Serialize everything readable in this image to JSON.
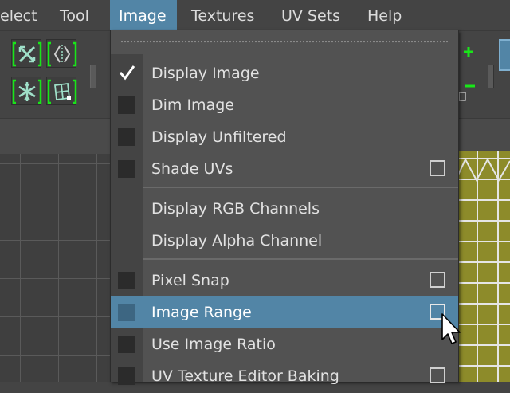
{
  "menubar": {
    "items": [
      {
        "label": "elect",
        "active": false
      },
      {
        "label": "Tool",
        "active": false
      },
      {
        "label": "Image",
        "active": true
      },
      {
        "label": "Textures",
        "active": false
      },
      {
        "label": "UV Sets",
        "active": false
      },
      {
        "label": "Help",
        "active": false
      }
    ]
  },
  "toolbar": {
    "left_buttons": [
      "unfold-icon",
      "mirror-icon",
      "snowflake-icon",
      "uv-grid-icon"
    ],
    "right_buttons": [
      "add-icon",
      "subtract-icon"
    ]
  },
  "image_menu": {
    "items": [
      {
        "label": "Display Image",
        "checked": true,
        "has_checkbox": true,
        "has_option_box": false,
        "highlighted": false
      },
      {
        "label": "Dim Image",
        "checked": false,
        "has_checkbox": true,
        "has_option_box": false,
        "highlighted": false
      },
      {
        "label": "Display Unfiltered",
        "checked": false,
        "has_checkbox": true,
        "has_option_box": false,
        "highlighted": false
      },
      {
        "label": "Shade UVs",
        "checked": false,
        "has_checkbox": true,
        "has_option_box": true,
        "highlighted": false
      },
      {
        "label": "Display RGB Channels",
        "checked": false,
        "has_checkbox": false,
        "has_option_box": false,
        "highlighted": false
      },
      {
        "label": "Display Alpha Channel",
        "checked": false,
        "has_checkbox": false,
        "has_option_box": false,
        "highlighted": false
      },
      {
        "label": "Pixel Snap",
        "checked": false,
        "has_checkbox": true,
        "has_option_box": true,
        "highlighted": false
      },
      {
        "label": "Image Range",
        "checked": false,
        "has_checkbox": true,
        "has_option_box": true,
        "highlighted": true
      },
      {
        "label": "Use Image Ratio",
        "checked": false,
        "has_checkbox": true,
        "has_option_box": false,
        "highlighted": false
      },
      {
        "label": "UV Texture Editor Baking",
        "checked": false,
        "has_checkbox": true,
        "has_option_box": true,
        "highlighted": false
      }
    ]
  },
  "colors": {
    "menu_bg": "#525252",
    "highlight": "#5285a6",
    "toolbar_green": "#19e619",
    "uv_mesh": "#8d8b2a"
  }
}
